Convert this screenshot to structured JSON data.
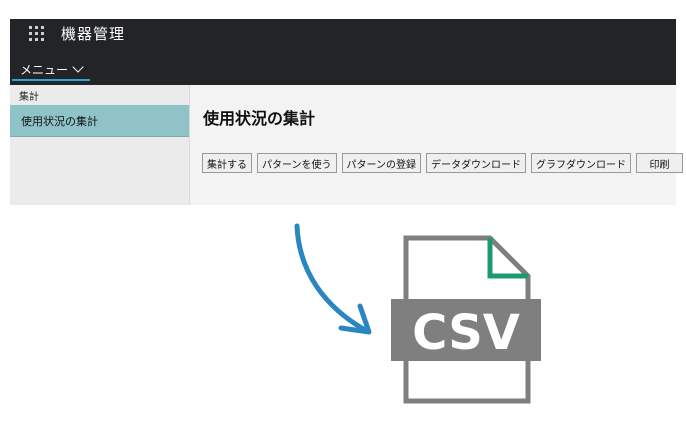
{
  "app": {
    "title": "機器管理"
  },
  "menu": {
    "label": "メニュー"
  },
  "sidebar": {
    "group": "集計",
    "items": [
      {
        "label": "使用状況の集計"
      }
    ]
  },
  "main": {
    "title": "使用状況の集計",
    "buttons": [
      {
        "label": "集計する"
      },
      {
        "label": "パターンを使う"
      },
      {
        "label": "パターンの登録"
      },
      {
        "label": "データダウンロード"
      },
      {
        "label": "グラフダウンロード"
      },
      {
        "label": "印刷"
      }
    ]
  },
  "file_icon": {
    "label": "CSV",
    "colors": {
      "body": "#7f7f7f",
      "fold": "#1b9a72",
      "arrow": "#2a86c2"
    }
  },
  "icons": [
    "waffle-icon",
    "chevron-down-icon",
    "arrow-icon",
    "csv-file-icon"
  ]
}
